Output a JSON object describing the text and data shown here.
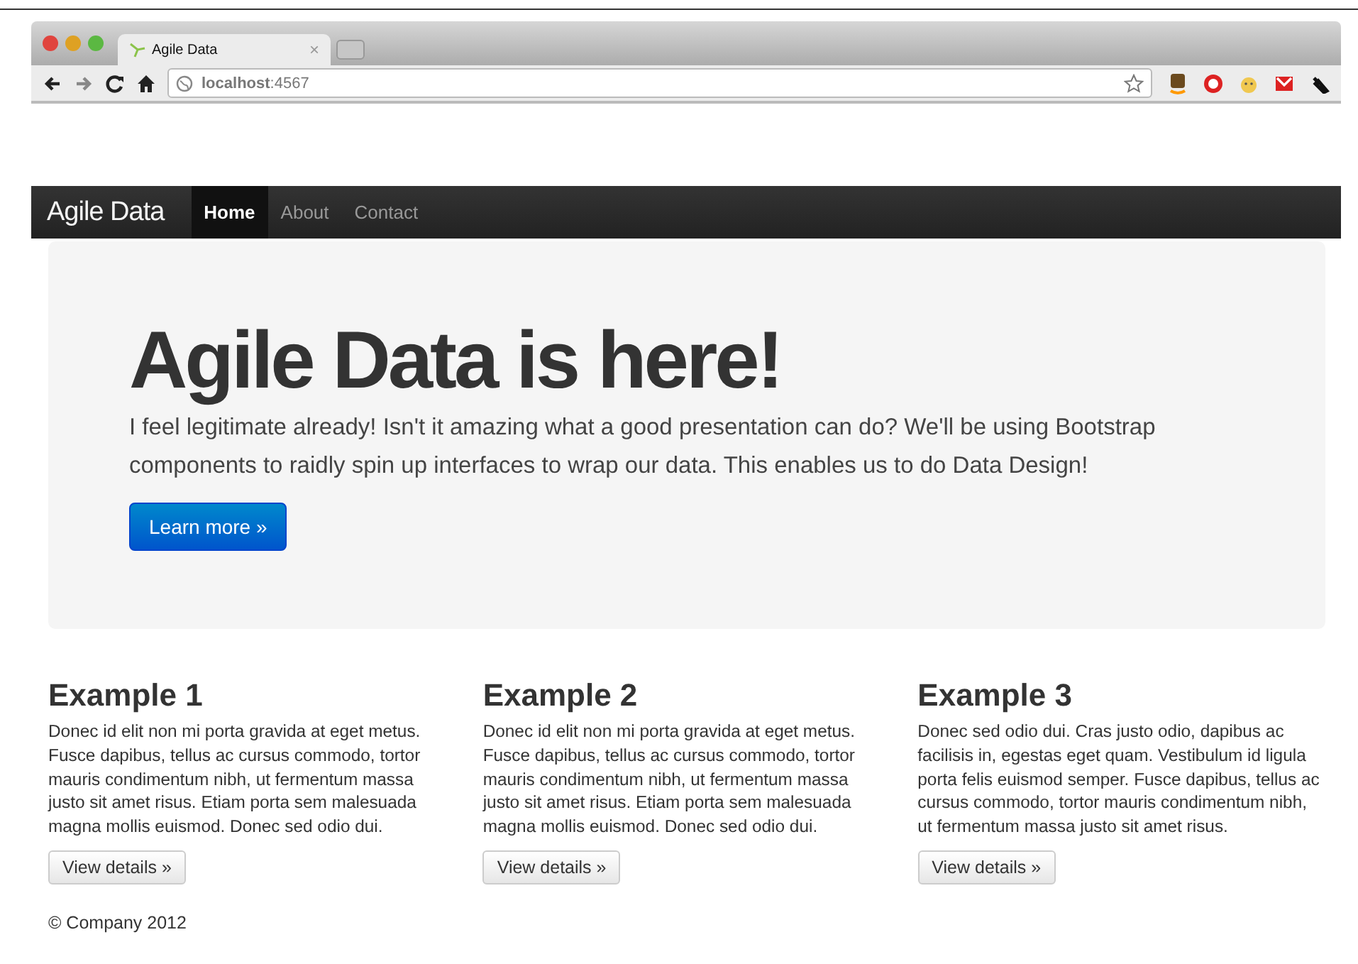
{
  "browser": {
    "tab_title": "Agile Data",
    "close": "×",
    "address": "**localhost**:4567"
  },
  "navbar": {
    "brand": "Agile Data",
    "links": [
      {
        "label": "Home",
        "selected": true
      },
      {
        "label": "About",
        "selected": false
      },
      {
        "label": "Contact",
        "selected": false
      }
    ]
  },
  "hero": {
    "heading": "Agile Data is here!",
    "text": "I feel legitimate already! Isn't it amazing what a good presentation can do? We'll be using Bootstrap components to raidly spin up interfaces to wrap our data. This enables us to do Data Design!",
    "button": "Learn more »"
  },
  "columns": [
    {
      "heading": "Example 1",
      "text": "Donec id elit non mi porta gravida at eget metus. Fusce dapibus, tellus ac cursus commodo, tortor mauris condimentum nibh, ut fermentum massa justo sit amet risus. Etiam porta sem malesuada magna mollis euismod. Donec sed odio dui.",
      "button": "View details »"
    },
    {
      "heading": "Example 2",
      "text": "Donec id elit non mi porta gravida at eget metus. Fusce dapibus, tellus ac cursus commodo, tortor mauris condimentum nibh, ut fermentum massa justo sit amet risus. Etiam porta sem malesuada magna mollis euismod. Donec sed odio dui.",
      "button": "View details »"
    },
    {
      "heading": "Example 3",
      "text": "Donec sed odio dui. Cras justo odio, dapibus ac facilisis in, egestas eget quam. Vestibulum id ligula porta felis euismod semper. Fusce dapibus, tellus ac cursus commodo, tortor mauris condimentum nibh, ut fermentum massa justo sit amet risus.",
      "button": "View details »"
    }
  ],
  "footer": "© Company 2012"
}
